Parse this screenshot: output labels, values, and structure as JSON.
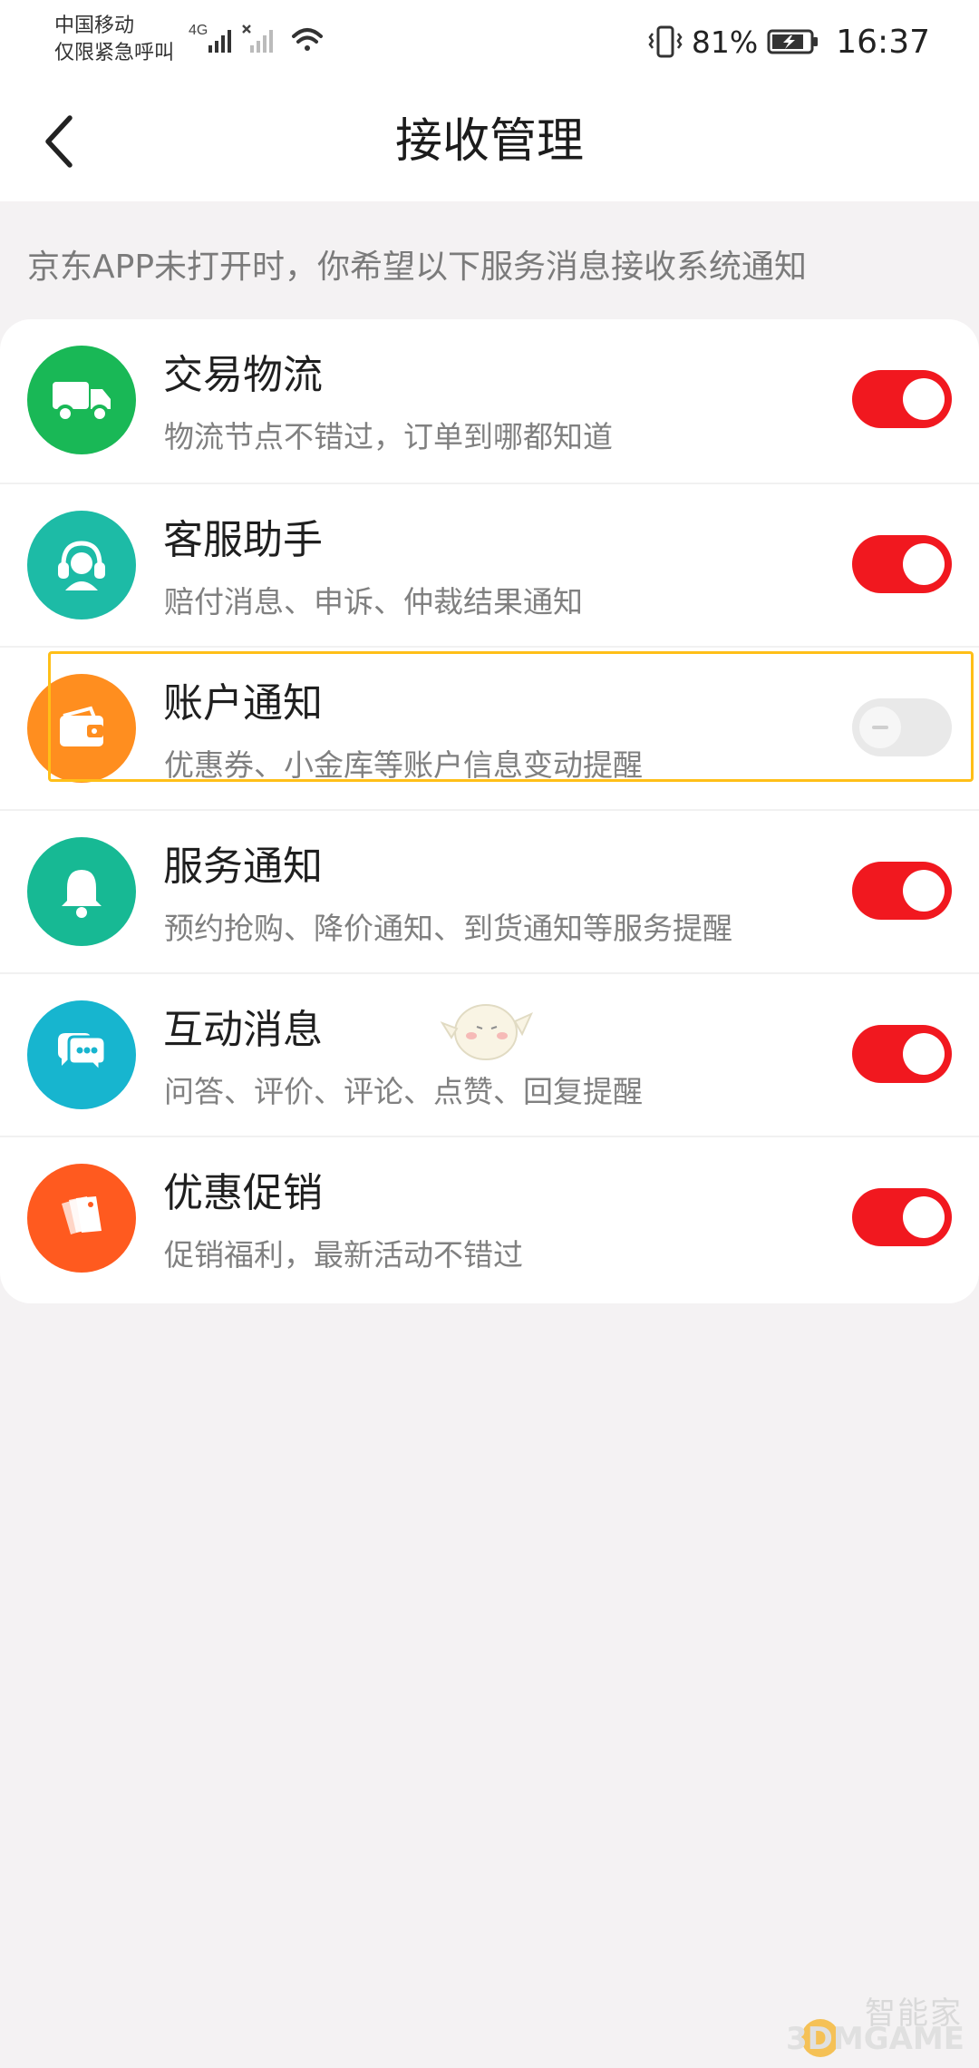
{
  "status_bar": {
    "carrier_line1": "中国移动",
    "carrier_line2": "仅限紧急呼叫",
    "network_type": "4G",
    "battery_percent": "81%",
    "time": "16:37"
  },
  "nav": {
    "title": "接收管理"
  },
  "section_tip": "京东APP未打开时，你希望以下服务消息接收系统通知",
  "items": [
    {
      "title": "交易物流",
      "subtitle": "物流节点不错过，订单到哪都知道",
      "icon": "truck-icon",
      "icon_color": "#19b856",
      "enabled": true
    },
    {
      "title": "客服助手",
      "subtitle": "赔付消息、申诉、仲裁结果通知",
      "icon": "headset-icon",
      "icon_color": "#1dbba6",
      "enabled": true
    },
    {
      "title": "账户通知",
      "subtitle": "优惠券、小金库等账户信息变动提醒",
      "icon": "wallet-icon",
      "icon_color": "#ff8e1f",
      "enabled": false
    },
    {
      "title": "服务通知",
      "subtitle": "预约抢购、降价通知、到货通知等服务提醒",
      "icon": "bell-icon",
      "icon_color": "#17b994",
      "enabled": true
    },
    {
      "title": "互动消息",
      "subtitle": "问答、评价、评论、点赞、回复提醒",
      "icon": "chat-icon",
      "icon_color": "#17b5cf",
      "enabled": true
    },
    {
      "title": "优惠促销",
      "subtitle": "促销福利，最新活动不错过",
      "icon": "tags-icon",
      "icon_color": "#ff5a1f",
      "enabled": true
    }
  ],
  "watermark": {
    "line1": "智能家",
    "line2": "3DMGAME"
  },
  "colors": {
    "switch_on": "#f1181f",
    "switch_off": "#e9e9e9",
    "highlight_border": "#ffbf18"
  }
}
